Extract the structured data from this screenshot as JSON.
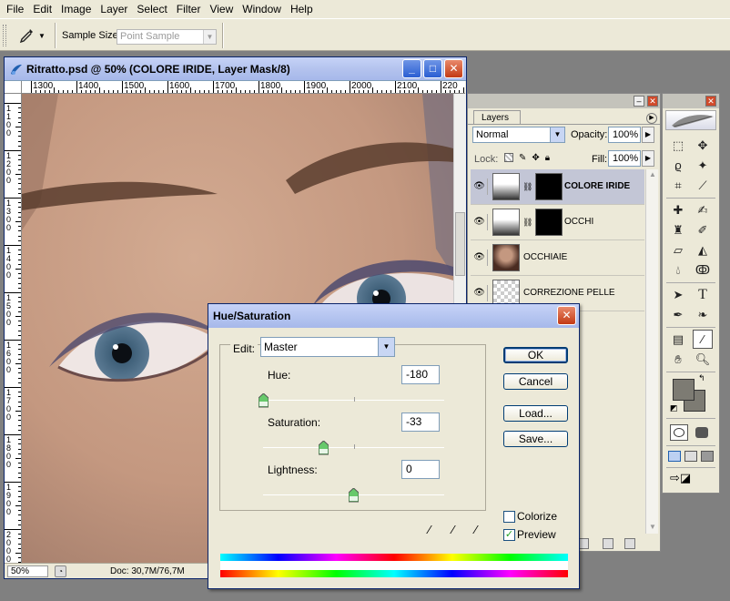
{
  "menubar": {
    "items": [
      {
        "id": "file",
        "label": "File"
      },
      {
        "id": "edit",
        "label": "Edit"
      },
      {
        "id": "image",
        "label": "Image"
      },
      {
        "id": "layer",
        "label": "Layer"
      },
      {
        "id": "select",
        "label": "Select"
      },
      {
        "id": "filter",
        "label": "Filter"
      },
      {
        "id": "view",
        "label": "View"
      },
      {
        "id": "window",
        "label": "Window"
      },
      {
        "id": "help",
        "label": "Help"
      }
    ]
  },
  "options_bar": {
    "tool_icon": "eyedropper-icon",
    "sample_size_label": "Sample Size:",
    "sample_size_value": "Point Sample"
  },
  "document": {
    "title": "Ritratto.psd @ 50% (COLORE IRIDE, Layer Mask/8)",
    "ruler_h": [
      "1300",
      "1400",
      "1500",
      "1600",
      "1700",
      "1800",
      "1900",
      "2000",
      "2100",
      "220"
    ],
    "ruler_v": [
      "1100",
      "1200",
      "1300",
      "1400",
      "1500",
      "1600",
      "1700",
      "1800",
      "1900",
      "2000"
    ],
    "zoom": "50%",
    "doc_info": "Doc: 30,7M/76,7M",
    "buttons": {
      "minimize": "_",
      "maximize": "□",
      "close": "✕"
    }
  },
  "layers_panel": {
    "tab_label": "Layers",
    "blend_mode": "Normal",
    "opacity_label": "Opacity:",
    "opacity_value": "100%",
    "lock_label": "Lock:",
    "fill_label": "Fill:",
    "fill_value": "100%",
    "layers": [
      {
        "name": "COLORE IRIDE",
        "visible": true,
        "active": true,
        "type": "adjustment-with-mask"
      },
      {
        "name": "OCCHI",
        "visible": true,
        "active": false,
        "type": "adjustment-with-mask"
      },
      {
        "name": "OCCHIAIE",
        "visible": true,
        "active": false,
        "type": "image"
      },
      {
        "name": "CORREZIONE PELLE",
        "visible": true,
        "active": false,
        "type": "transparent"
      }
    ]
  },
  "tools_panel": {
    "tools": [
      "marquee-icon",
      "move-icon",
      "lasso-icon",
      "magic-wand-icon",
      "crop-icon",
      "slice-icon",
      "healing-brush-icon",
      "brush-icon",
      "clone-stamp-icon",
      "history-brush-icon",
      "eraser-icon",
      "paint-bucket-icon",
      "blur-icon",
      "dodge-icon",
      "path-selection-icon",
      "type-icon",
      "pen-icon",
      "custom-shape-icon",
      "notes-icon",
      "eyedropper-icon",
      "hand-icon",
      "zoom-icon"
    ],
    "active_tool": "eyedropper-icon",
    "foreground_color": "#7d7b73",
    "background_color": "#7d7b73",
    "type_label": "T"
  },
  "hue_saturation": {
    "title": "Hue/Saturation",
    "edit_label": "Edit:",
    "edit_value": "Master",
    "hue_label": "Hue:",
    "hue_value": "-180",
    "hue_fraction": 0.0,
    "saturation_label": "Saturation:",
    "saturation_value": "-33",
    "saturation_fraction": 0.335,
    "lightness_label": "Lightness:",
    "lightness_value": "0",
    "lightness_fraction": 0.5,
    "ok_label": "OK",
    "cancel_label": "Cancel",
    "load_label": "Load...",
    "save_label": "Save...",
    "colorize_label": "Colorize",
    "colorize_checked": false,
    "preview_label": "Preview",
    "preview_checked": true
  },
  "colors": {
    "accent": "#0a246a",
    "ui_face": "#ece9d8",
    "skin_tone": "#c59a83"
  }
}
